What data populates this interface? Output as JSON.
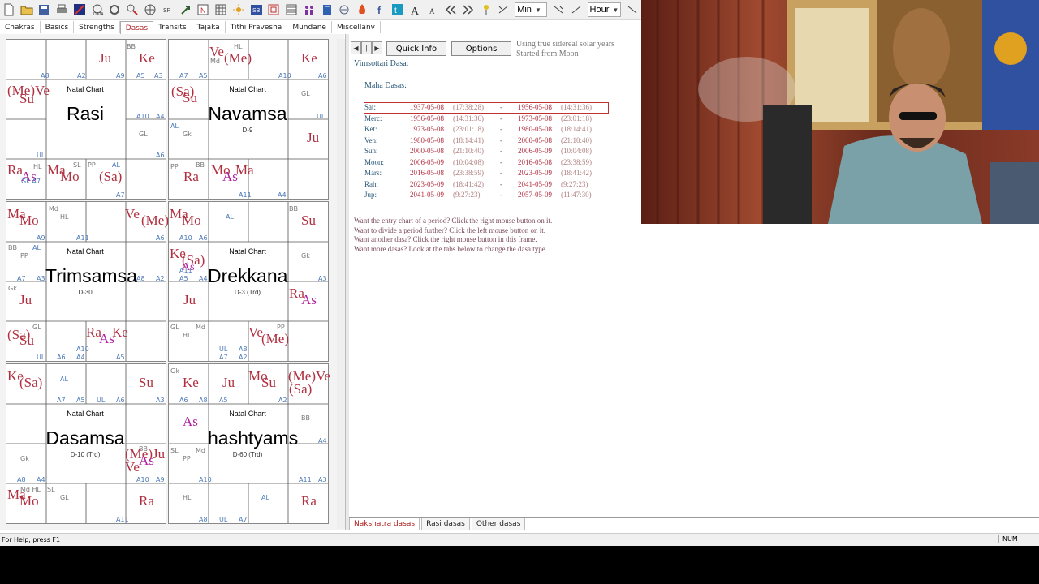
{
  "toolbar": {
    "min_combo": "Min",
    "hour_combo": "Hour"
  },
  "tabs": [
    "Chakras",
    "Basics",
    "Strengths",
    "Dasas",
    "Transits",
    "Tajaka",
    "Tithi Pravesha",
    "Mundane",
    "Miscellanv"
  ],
  "charts": [
    {
      "title": "Natal Chart",
      "name": "Rasi",
      "sub": ""
    },
    {
      "title": "Natal Chart",
      "name": "Navamsa",
      "sub": "D-9"
    },
    {
      "title": "Natal Chart",
      "name": "Trimsamsa",
      "sub": "D-30"
    },
    {
      "title": "Natal Chart",
      "name": "Drekkana",
      "sub": "D-3 (Trd)"
    },
    {
      "title": "Natal Chart",
      "name": "Dasamsa",
      "sub": "D-10 (Trd)"
    },
    {
      "title": "Natal Chart",
      "name": "hashtyams",
      "sub": "D-60 (Trd)"
    }
  ],
  "right": {
    "quick_info": "Quick Info",
    "options": "Options",
    "note_line1": "Using true sidereal solar years",
    "note_line2": "Started from Moon",
    "dasa_title": "Vimsottari Dasa:",
    "maha_label": "Maha Dasas:",
    "rows": [
      {
        "p": "Sat:",
        "d1": "1937-05-08",
        "t1": "(17:38:28)",
        "dash": "-",
        "d2": "1956-05-08",
        "t2": "(14:31:36)"
      },
      {
        "p": "Merc:",
        "d1": "1956-05-08",
        "t1": "(14:31:36)",
        "dash": "-",
        "d2": "1973-05-08",
        "t2": "(23:01:18)"
      },
      {
        "p": "Ket:",
        "d1": "1973-05-08",
        "t1": "(23:01:18)",
        "dash": "-",
        "d2": "1980-05-08",
        "t2": "(18:14:41)"
      },
      {
        "p": "Ven:",
        "d1": "1980-05-08",
        "t1": "(18:14:41)",
        "dash": "-",
        "d2": "2000-05-08",
        "t2": "(21:10:40)"
      },
      {
        "p": "Sun:",
        "d1": "2000-05-08",
        "t1": "(21:10:40)",
        "dash": "-",
        "d2": "2006-05-09",
        "t2": "(10:04:08)"
      },
      {
        "p": "Moon:",
        "d1": "2006-05-09",
        "t1": "(10:04:08)",
        "dash": "-",
        "d2": "2016-05-08",
        "t2": "(23:38:59)"
      },
      {
        "p": "Mars:",
        "d1": "2016-05-08",
        "t1": "(23:38:59)",
        "dash": "-",
        "d2": "2023-05-09",
        "t2": "(18:41:42)"
      },
      {
        "p": "Rah:",
        "d1": "2023-05-09",
        "t1": "(18:41:42)",
        "dash": "-",
        "d2": "2041-05-09",
        "t2": "(9:27:23)"
      },
      {
        "p": "Jup:",
        "d1": "2041-05-09",
        "t1": "(9:27:23)",
        "dash": "-",
        "d2": "2057-05-09",
        "t2": "(11:47:30)"
      }
    ],
    "help": [
      "Want the entry chart of a period? Click the right mouse button on it.",
      "Want to divide a period further? Click the left mouse button on it.",
      "Want another dasa? Click the right mouse button in this frame.",
      "Want more dasas? Look at the tabs below to change the dasa type."
    ],
    "bottom_tabs": [
      "Nakshatra dasas",
      "Rasi dasas",
      "Other dasas"
    ]
  },
  "status": {
    "help_text": "For Help, press F1",
    "num": "NUM"
  }
}
